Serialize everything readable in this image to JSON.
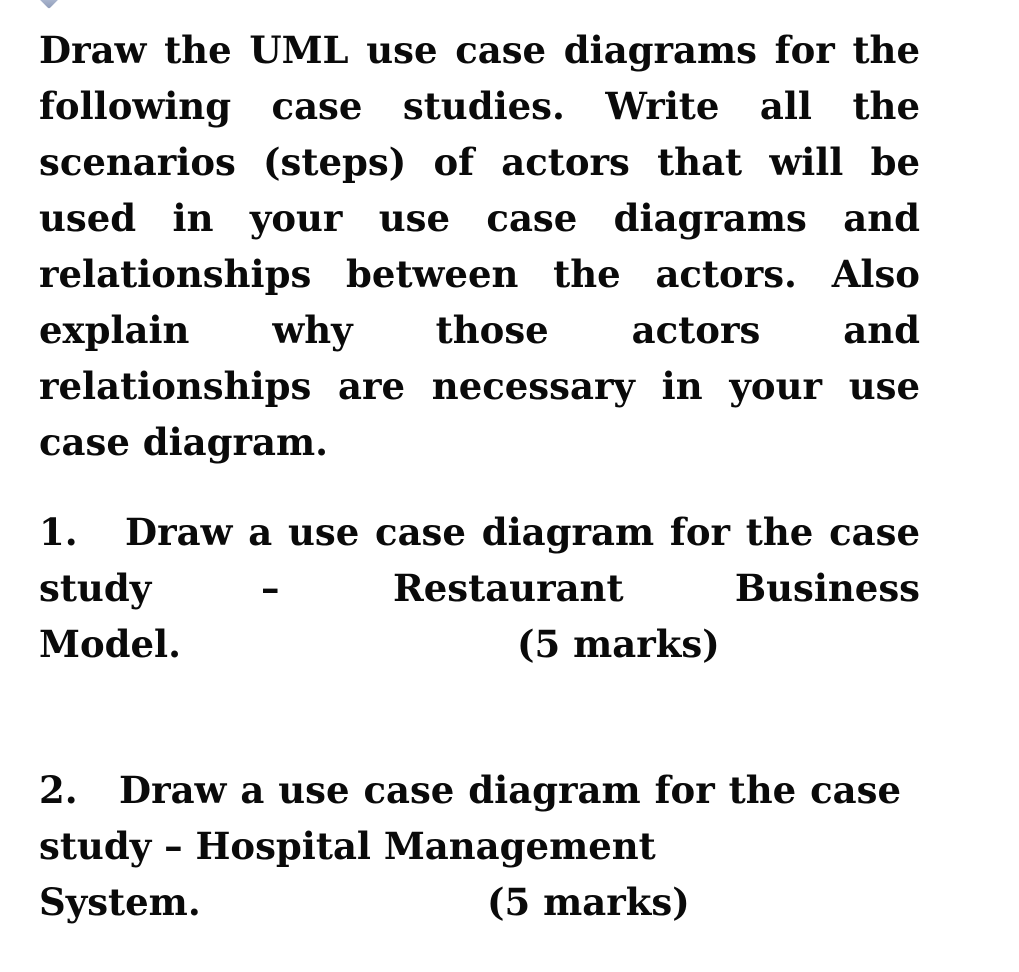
{
  "marker_icon": "diamond-chevron-icon",
  "instructions": {
    "lines": [
      "Draw the UML use case diagrams for the",
      "following case studies. Write all the",
      "scenarios (steps) of actors that will be",
      "used in your use case diagrams and",
      "relationships between the actors. Also",
      "explain why those actors and",
      "relationships are necessary in your use",
      "case diagram."
    ]
  },
  "questions": [
    {
      "number": "1.",
      "line1": "Draw a use case diagram for the case",
      "line2_parts": [
        "study",
        "–",
        "Restaurant",
        "Business"
      ],
      "line3_text": "Model.",
      "marks": "(5 marks)"
    },
    {
      "number": "2.",
      "line1": "Draw a use case diagram for the case",
      "line2": "study – Hospital Management",
      "line3_text": "System.",
      "marks": "(5 marks)"
    }
  ]
}
